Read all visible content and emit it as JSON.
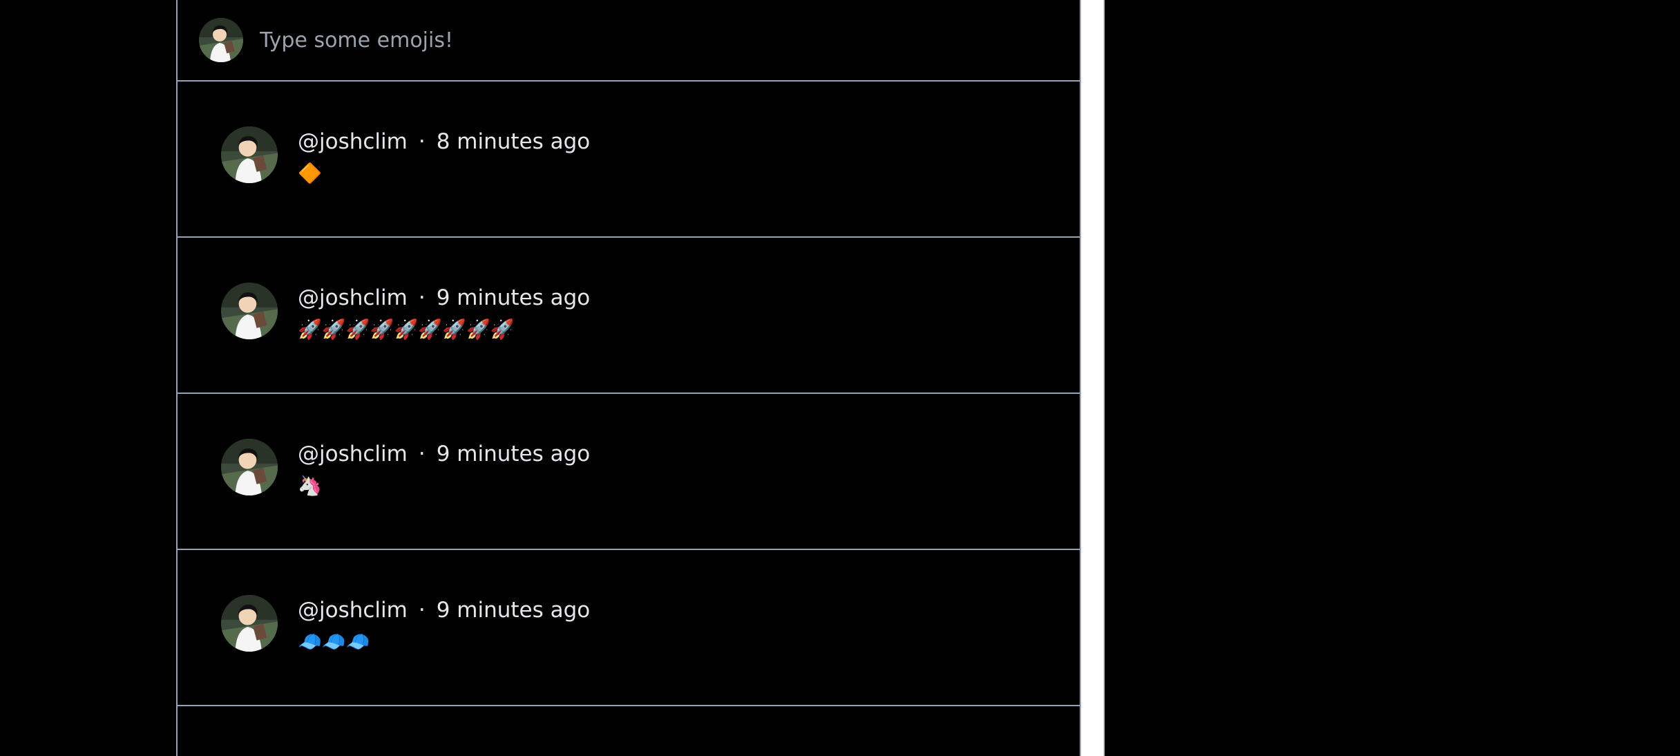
{
  "composer": {
    "placeholder": "Type some emojis!",
    "value": ""
  },
  "posts": [
    {
      "author": "@joshclim",
      "separator": "·",
      "time": "8 minutes ago",
      "content": "🔶"
    },
    {
      "author": "@joshclim",
      "separator": "·",
      "time": "9 minutes ago",
      "content": "🚀🚀🚀🚀🚀🚀🚀🚀🚀"
    },
    {
      "author": "@joshclim",
      "separator": "·",
      "time": "9 minutes ago",
      "content": "🦄"
    },
    {
      "author": "@joshclim",
      "separator": "·",
      "time": "9 minutes ago",
      "content": "🧢🧢🧢"
    }
  ],
  "colors": {
    "background": "#000000",
    "divider": "#94a3b8",
    "text": "#e5e7eb",
    "placeholder": "#9ca3af"
  }
}
